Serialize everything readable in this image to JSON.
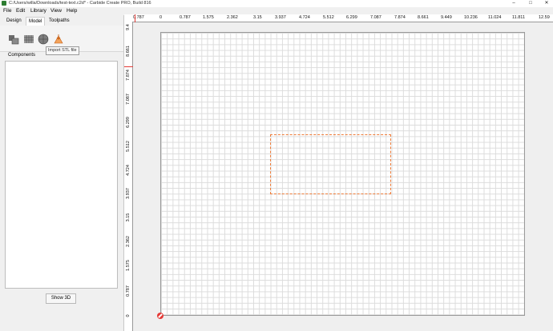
{
  "window": {
    "title": "C:/Users/willa/Downloads/test-text.c2d* - Carbide Create PRO, Build 816",
    "minimize": "–",
    "maximize": "□",
    "close": "✕"
  },
  "menu": [
    "File",
    "Edit",
    "Library",
    "View",
    "Help"
  ],
  "tabs": [
    "Design",
    "Model",
    "Toolpaths"
  ],
  "active_tab": "Model",
  "toolbar_icons": [
    "cube-import-icon",
    "mesh-grid-icon",
    "sphere-icon",
    "import-stl-icon"
  ],
  "tooltip": "Import STL file",
  "components_label": "Components",
  "show3d_label": "Show 3D",
  "ruler_top": [
    "0.787",
    "0",
    "0.787",
    "1.575",
    "2.362",
    "3.15",
    "3.937",
    "4.724",
    "5.512",
    "6.299",
    "7.087",
    "7.874",
    "8.661",
    "9.449",
    "10.236",
    "11.024",
    "11.811",
    "12.59"
  ],
  "ruler_left": [
    "9.4",
    "8.661",
    "7.874",
    "7.087",
    "6.299",
    "5.512",
    "4.724",
    "3.937",
    "3.15",
    "2.362",
    "1.575",
    "0.787",
    "0"
  ],
  "colors": {
    "selection_rect": "#f07d3a",
    "origin_marker": "#e53935",
    "grid_line": "#dcdcdc"
  }
}
